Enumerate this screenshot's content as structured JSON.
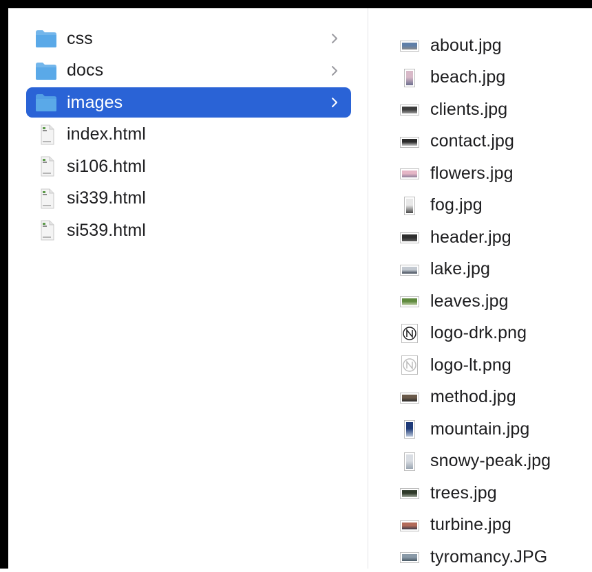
{
  "columns": {
    "left": [
      {
        "name": "css",
        "icon": "folder-icon",
        "expandable": true,
        "selected": false
      },
      {
        "name": "docs",
        "icon": "folder-icon",
        "expandable": true,
        "selected": false
      },
      {
        "name": "images",
        "icon": "folder-icon",
        "expandable": true,
        "selected": true
      },
      {
        "name": "index.html",
        "icon": "html-file-icon",
        "expandable": false,
        "selected": false
      },
      {
        "name": "si106.html",
        "icon": "html-file-icon",
        "expandable": false,
        "selected": false
      },
      {
        "name": "si339.html",
        "icon": "html-file-icon",
        "expandable": false,
        "selected": false
      },
      {
        "name": "si539.html",
        "icon": "html-file-icon",
        "expandable": false,
        "selected": false
      }
    ],
    "right": [
      {
        "name": "about.jpg",
        "icon": "image-thumbnail-icon",
        "thumb_colors": [
          "#5f7fa8",
          "#8a8a8a"
        ]
      },
      {
        "name": "beach.jpg",
        "icon": "image-thumbnail-icon",
        "thumb_colors": [
          "#d8b9c8",
          "#6d6f8f"
        ]
      },
      {
        "name": "clients.jpg",
        "icon": "image-thumbnail-icon",
        "thumb_colors": [
          "#3d3d3d",
          "#9a9a9a"
        ]
      },
      {
        "name": "contact.jpg",
        "icon": "image-thumbnail-icon",
        "thumb_colors": [
          "#2b2b2b",
          "#c9c9c9"
        ]
      },
      {
        "name": "flowers.jpg",
        "icon": "image-thumbnail-icon",
        "thumb_colors": [
          "#e5b6c6",
          "#8f7f9a"
        ]
      },
      {
        "name": "fog.jpg",
        "icon": "image-thumbnail-icon",
        "thumb_colors": [
          "#e8e8e8",
          "#4a4a4a"
        ]
      },
      {
        "name": "header.jpg",
        "icon": "image-thumbnail-icon",
        "thumb_colors": [
          "#2e2e2e",
          "#5a5a5a"
        ]
      },
      {
        "name": "lake.jpg",
        "icon": "image-thumbnail-icon",
        "thumb_colors": [
          "#c3c9d1",
          "#3d4754"
        ]
      },
      {
        "name": "leaves.jpg",
        "icon": "image-thumbnail-icon",
        "thumb_colors": [
          "#5f8a3e",
          "#c7d4b0"
        ]
      },
      {
        "name": "logo-drk.png",
        "icon": "logo-dark-icon",
        "thumb_colors": [
          "#ffffff",
          "#1d1d1f"
        ]
      },
      {
        "name": "logo-lt.png",
        "icon": "logo-light-icon",
        "thumb_colors": [
          "#ffffff",
          "#bdbdbd"
        ]
      },
      {
        "name": "method.jpg",
        "icon": "image-thumbnail-icon",
        "thumb_colors": [
          "#6a5a4a",
          "#2b2b2b"
        ]
      },
      {
        "name": "mountain.jpg",
        "icon": "image-thumbnail-icon",
        "thumb_colors": [
          "#1e3a78",
          "#b9c6d9"
        ]
      },
      {
        "name": "snowy-peak.jpg",
        "icon": "image-thumbnail-icon",
        "thumb_colors": [
          "#d9dde3",
          "#9aa5b1"
        ]
      },
      {
        "name": "trees.jpg",
        "icon": "image-thumbnail-icon",
        "thumb_colors": [
          "#2f3a2a",
          "#9fa79a"
        ]
      },
      {
        "name": "turbine.jpg",
        "icon": "image-thumbnail-icon",
        "thumb_colors": [
          "#b36b5a",
          "#3b3b4a"
        ]
      },
      {
        "name": "tyromancy.JPG",
        "icon": "image-thumbnail-icon",
        "thumb_colors": [
          "#8a9aa8",
          "#4a5a66"
        ]
      }
    ]
  },
  "colors": {
    "selection": "#2a63d6",
    "folder": "#5aa9e8",
    "chevron": "#9a9aa0"
  }
}
